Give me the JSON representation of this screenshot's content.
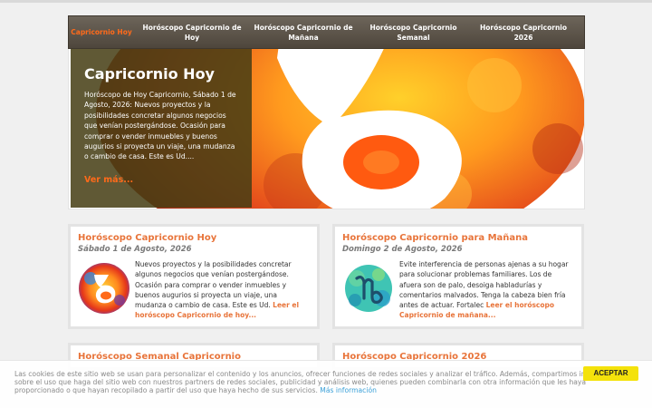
{
  "nav": {
    "items": [
      {
        "label": "Capricornio Hoy"
      },
      {
        "label": "Horóscopo Capricornio de Hoy"
      },
      {
        "label": "Horóscopo Capricornio de Mañana"
      },
      {
        "label": "Horóscopo Capricornio Semanal"
      },
      {
        "label": "Horóscopo Capricornio 2026"
      }
    ]
  },
  "hero": {
    "title": "Capricornio Hoy",
    "text": "Horóscopo de Hoy Capricornio, Sábado 1 de Agosto, 2026: Nuevos proyectos y la posibilidades concretar algunos negocios que venían postergándose. Ocasión para comprar o vender inmuebles y buenos augurios si proyecta un viaje, una mudanza o cambio de casa. Este es Ud....",
    "more": "Ver más...",
    "icon": "capricorn-symbol-icon"
  },
  "cards": [
    {
      "title": "Horóscopo Capricornio Hoy",
      "date": "Sábado 1 de Agosto, 2026",
      "text": "Nuevos proyectos y la posibilidades concretar algunos negocios que venían postergándose. Ocasión para comprar o vender inmuebles y buenos augurios si proyecta un viaje, una mudanza o cambio de casa. Este es Ud. ",
      "link": "Leer el horóscopo Capricornio de hoy...",
      "icon": "capricorn-symbol-icon"
    },
    {
      "title": "Horóscopo Capricornio para Mañana",
      "date": "Domingo 2 de Agosto, 2026",
      "text": "Evite interferencia de personas ajenas a su hogar para solucionar problemas familiares. Los de afuera son de palo, desoiga habladurías y comentarios malvados. Tenga la cabeza bien fría antes de actuar. Fortalec ",
      "link": "Leer el horóscopo Capricornio de mañana...",
      "icon": "capricorn-glyph-icon"
    },
    {
      "title": "Horóscopo Semanal Capricornio"
    },
    {
      "title": "Horóscopo Capricornio 2026"
    }
  ],
  "cookie": {
    "text": "Las cookies de este sitio web se usan para personalizar el contenido y los anuncios, ofrecer funciones de redes sociales y analizar el tráfico. Además, compartimos información sobre el uso que haga del sitio web con nuestros partners de redes sociales, publicidad y análisis web, quienes pueden combinarla con otra información que les haya proporcionado o que hayan recopilado a partir del uso que haya hecho de sus servicios. ",
    "link": "Más información",
    "accept": "ACEPTAR"
  },
  "colors": {
    "accent": "#e8743a",
    "nav_active": "#ff6a1a",
    "cookie_button": "#f4e20b"
  }
}
